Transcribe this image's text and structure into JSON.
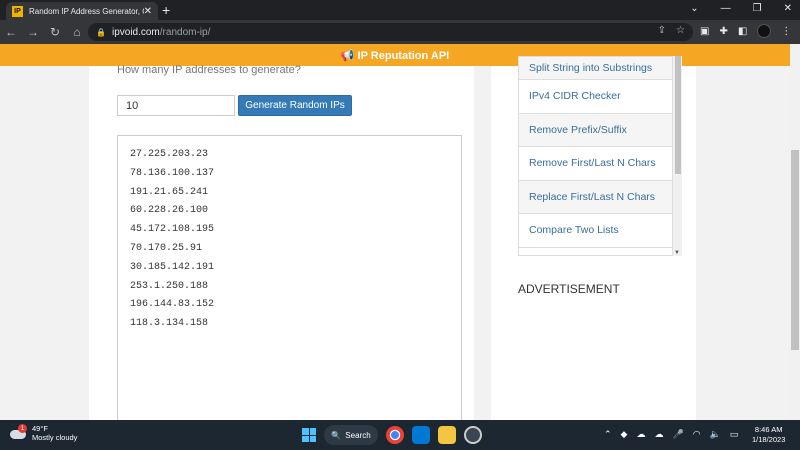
{
  "browser": {
    "tab_title": "Random IP Address Generator, Ge",
    "favicon_text": "IP",
    "url_host": "ipvoid.com",
    "url_path": "/random-ip/"
  },
  "banner": {
    "text": "📢 IP Reputation API"
  },
  "generator": {
    "question": "How many IP addresses to generate?",
    "count_value": "10",
    "button_label": "Generate Random IPs",
    "ips": [
      "27.225.203.23",
      "78.136.100.137",
      "191.21.65.241",
      "60.228.26.100",
      "45.172.108.195",
      "70.170.25.91",
      "30.185.142.191",
      "253.1.250.188",
      "196.144.83.152",
      "118.3.134.158"
    ]
  },
  "sidebar": {
    "items": [
      "Split String into Substrings",
      "IPv4 CIDR Checker",
      "Remove Prefix/Suffix",
      "Remove First/Last N Chars",
      "Replace First/Last N Chars",
      "Compare Two Lists"
    ],
    "advertisement": "ADVERTISEMENT"
  },
  "taskbar": {
    "weather_temp": "49°F",
    "weather_desc": "Mostly cloudy",
    "weather_badge": "1",
    "search_label": "Search",
    "time": "8:46 AM",
    "date": "1/18/2023"
  }
}
